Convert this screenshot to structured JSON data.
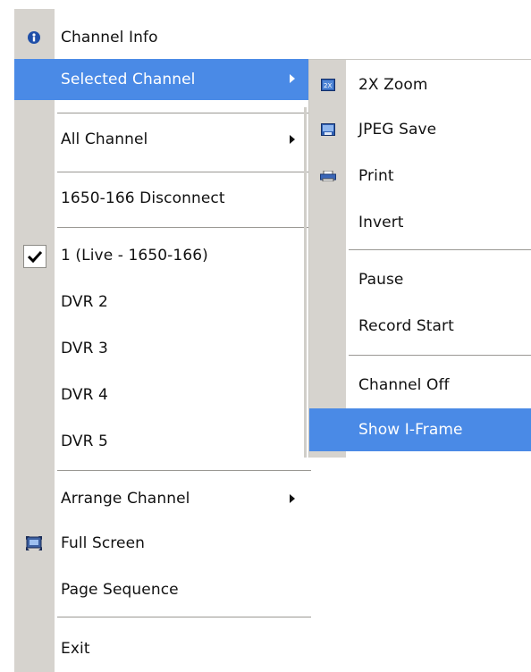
{
  "main_menu": {
    "items": [
      {
        "label": "Channel Info",
        "icon": "info-icon"
      },
      {
        "label": "Selected Channel",
        "has_submenu": true,
        "highlighted": true
      },
      {
        "label": "All Channel",
        "has_submenu": true
      },
      {
        "label": "1650-166 Disconnect"
      },
      {
        "label": "1 (Live - 1650-166)",
        "checked": true,
        "icon": "checkmark-icon"
      },
      {
        "label": "DVR 2"
      },
      {
        "label": "DVR 3"
      },
      {
        "label": "DVR 4"
      },
      {
        "label": "DVR 5"
      },
      {
        "label": "Arrange Channel",
        "has_submenu": true
      },
      {
        "label": "Full Screen",
        "icon": "full-screen-icon"
      },
      {
        "label": "Page Sequence"
      },
      {
        "label": "Exit"
      }
    ]
  },
  "sub_menu": {
    "items": [
      {
        "label": "2X Zoom",
        "icon": "zoom-icon"
      },
      {
        "label": "JPEG Save",
        "icon": "save-image-icon"
      },
      {
        "label": "Print",
        "icon": "printer-icon"
      },
      {
        "label": "Invert"
      },
      {
        "label": "Pause"
      },
      {
        "label": "Record Start"
      },
      {
        "label": "Channel Off"
      },
      {
        "label": "Show I-Frame",
        "highlighted": true
      }
    ]
  },
  "colors": {
    "highlight": "#4a8ae6",
    "gutter": "#d6d3ce",
    "menu_bg": "#ffffff"
  }
}
